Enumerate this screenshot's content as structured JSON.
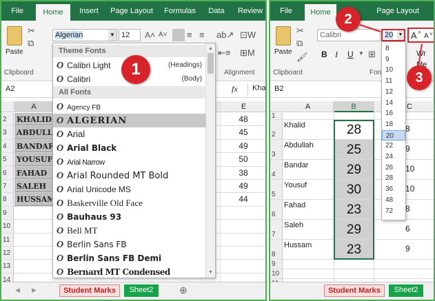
{
  "left": {
    "tabs": [
      {
        "label": "File"
      },
      {
        "label": "Home"
      },
      {
        "label": "Insert"
      },
      {
        "label": "Page Layout"
      },
      {
        "label": "Formulas"
      },
      {
        "label": "Data"
      },
      {
        "label": "Review"
      }
    ],
    "paste_label": "Paste",
    "clipboard_label": "Clipboard",
    "alignment_label": "Alignment",
    "font_name": "Algerian",
    "font_size": "12",
    "cell_ref": "A2",
    "fx": "fx",
    "formula_value": "Kha",
    "col_a": "A",
    "col_e": "E",
    "rows": [
      "2",
      "3",
      "4",
      "5",
      "6",
      "7",
      "8",
      "9",
      "10",
      "11",
      "12",
      "13",
      "14",
      "15",
      "16"
    ],
    "names": [
      "KHALID",
      "ABDULL",
      "BANDAR",
      "YOUSUF",
      "FAHAD",
      "SALEH",
      "HUSSAM"
    ],
    "e_values": [
      "48",
      "45",
      "49",
      "50",
      "38",
      "49",
      "44"
    ],
    "font_list": {
      "theme_header": "Theme Fonts",
      "theme": [
        {
          "name": "Calibri Light",
          "tag": "(Headings)"
        },
        {
          "name": "Calibri",
          "tag": "(Body)"
        }
      ],
      "all_header": "All Fonts",
      "fonts": [
        "Agency FB",
        "ALGERIAN",
        "Arial",
        "Arial Black",
        "Arial Narrow",
        "Arial Rounded MT Bold",
        "Arial Unicode MS",
        "Baskerville Old Face",
        "Bauhaus 93",
        "Bell MT",
        "Berlin Sans FB",
        "Berlin Sans FB Demi",
        "Bernard MT Condensed"
      ],
      "glyph": "O"
    },
    "sheet_tabs": [
      "Student Marks",
      "Sheet2"
    ],
    "badge": "1"
  },
  "right": {
    "tabs": [
      {
        "label": "File"
      },
      {
        "label": "Home"
      },
      {
        "label": "Page Layout"
      }
    ],
    "paste_label": "Paste",
    "clipboard_label": "Clipboard",
    "font_group_label": "Font",
    "font_name": "Calibri",
    "font_size": "20",
    "cell_ref": "B2",
    "wrap_label": "Wr",
    "merge_label": "Me",
    "col_a": "A",
    "col_b": "B",
    "col_c": "C",
    "rows": [
      "1",
      "2",
      "3",
      "4",
      "5",
      "6",
      "7",
      "8",
      "9",
      "10",
      "11",
      "12"
    ],
    "names": [
      "Khalid",
      "Abdullah",
      "Bandar",
      "Yousuf",
      "Fahad",
      "Saleh",
      "Hussam"
    ],
    "b_values": [
      "28",
      "25",
      "29",
      "30",
      "23",
      "29",
      "23"
    ],
    "c_values": [
      "8",
      "9",
      "10",
      "10",
      "8",
      "6",
      "9"
    ],
    "sizes": [
      "8",
      "9",
      "10",
      "11",
      "12",
      "14",
      "16",
      "18",
      "20",
      "22",
      "24",
      "26",
      "28",
      "36",
      "48",
      "72"
    ],
    "selected_size": "20",
    "sheet_tabs": [
      "Student Marks",
      "Sheet2"
    ],
    "badges": [
      "2",
      "3"
    ],
    "increase_font": "A",
    "decrease_font": "A"
  },
  "colors": {
    "excel_green": "#217346",
    "badge_red": "#d8232a",
    "highlight": "#c6d9f1",
    "border_green": "#4caf50"
  }
}
